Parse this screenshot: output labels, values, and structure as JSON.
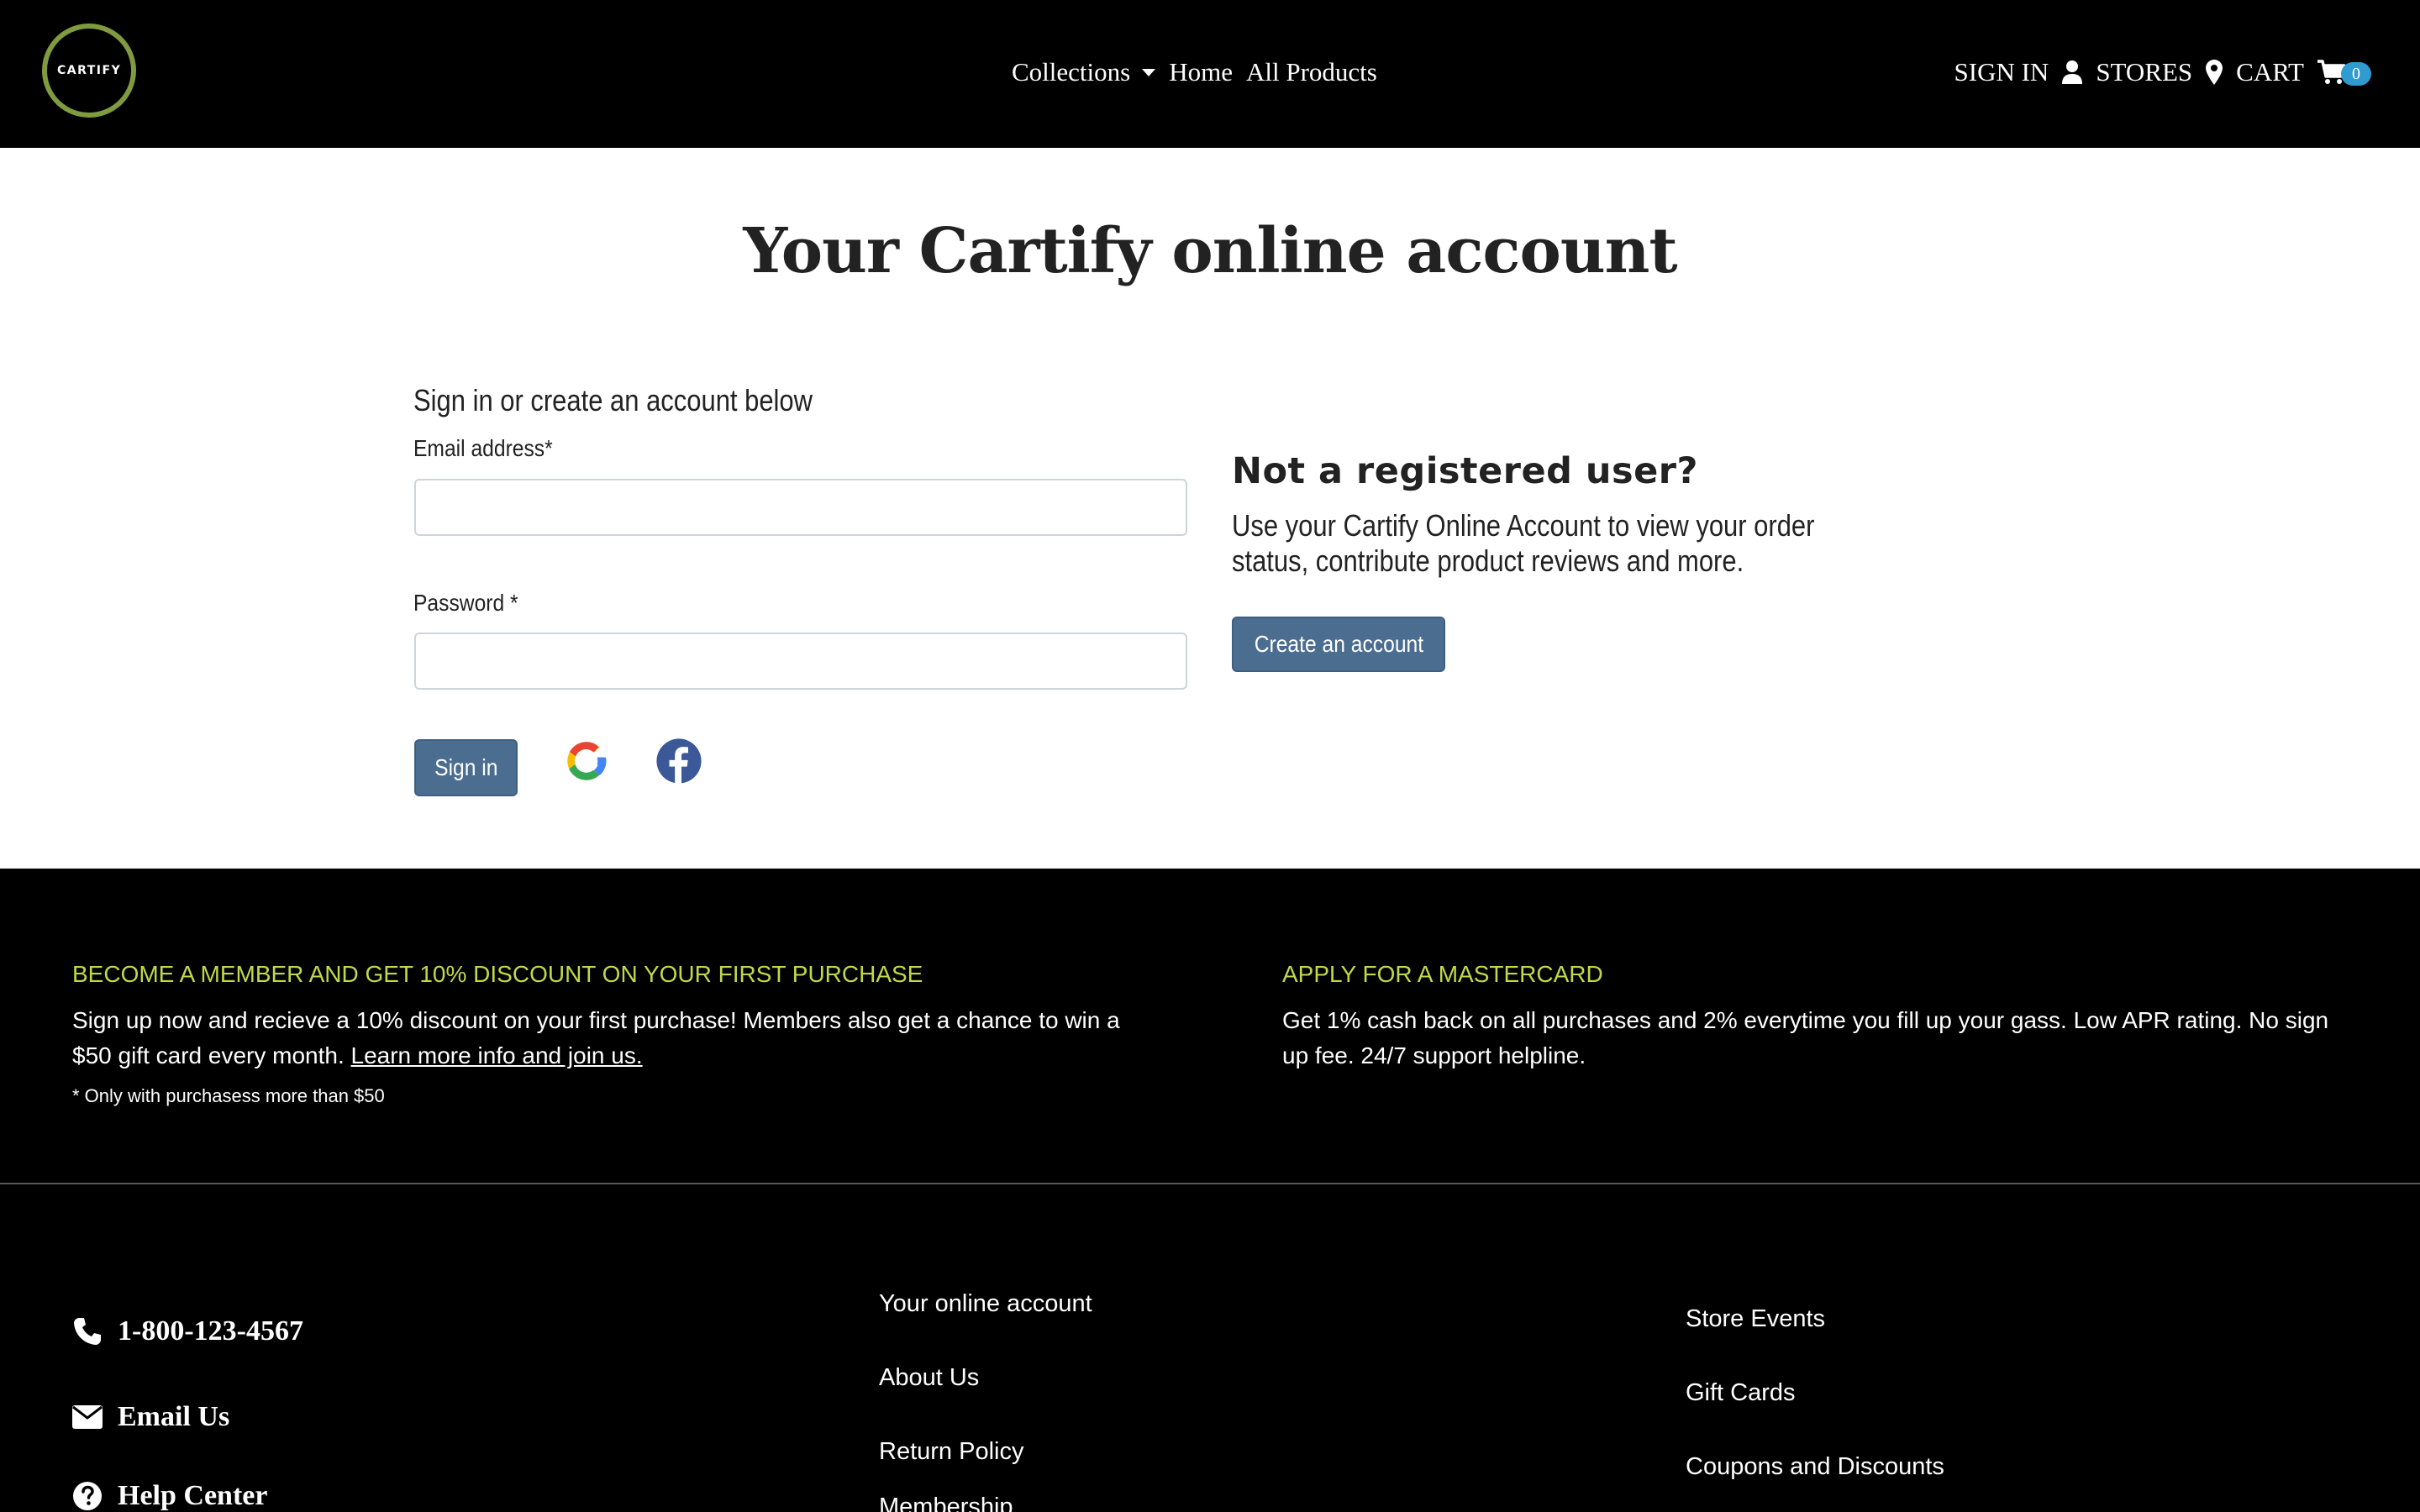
{
  "header": {
    "logo_text": "CARTIFY",
    "nav": {
      "collections": "Collections",
      "home": "Home",
      "all_products": "All Products"
    },
    "sign_in": "SIGN IN",
    "stores": "STORES",
    "cart": "CART",
    "cart_count": "0"
  },
  "main": {
    "title": "Your Cartify online account",
    "signin": {
      "subtitle": "Sign in or create an account below",
      "email_label": "Email address*",
      "email_value": "",
      "password_label": "Password *",
      "password_value": "",
      "signin_button": "Sign in",
      "google_icon": "google-icon",
      "facebook_icon": "facebook-icon"
    },
    "register": {
      "heading": "Not a registered user?",
      "text": "Use your Cartify Online Account to view your order status, contribute product reviews and more.",
      "button": "Create an account"
    }
  },
  "promo": {
    "member": {
      "title": "BECOME A MEMBER AND GET 10% DISCOUNT ON YOUR FIRST PURCHASE",
      "text": "Sign up now and recieve a 10% discount on your first purchase! Members also get a chance to win a $50 gift card every month.",
      "link": "Learn more info and join us.",
      "note": "* Only with purchasess more than $50"
    },
    "mastercard": {
      "title": "APPLY FOR A MASTERCARD",
      "text": "Get 1% cash back on all purchases and 2% everytime you fill up your gass. Low APR rating. No sign up fee. 24/7 support helpline."
    }
  },
  "footer": {
    "phone": "1-800-123-4567",
    "email": "Email Us",
    "help": "Help Center",
    "col2": [
      "Your online account",
      "About Us",
      "Return Policy",
      "Membership"
    ],
    "col3": [
      "Store Events",
      "Gift Cards",
      "Coupons and Discounts"
    ]
  },
  "colors": {
    "header_bg": "#000000",
    "accent_green": "#c2d84a",
    "logo_ring": "#7f9a3f",
    "button": "#4b6d90",
    "cart_badge": "#2f9bd0"
  }
}
